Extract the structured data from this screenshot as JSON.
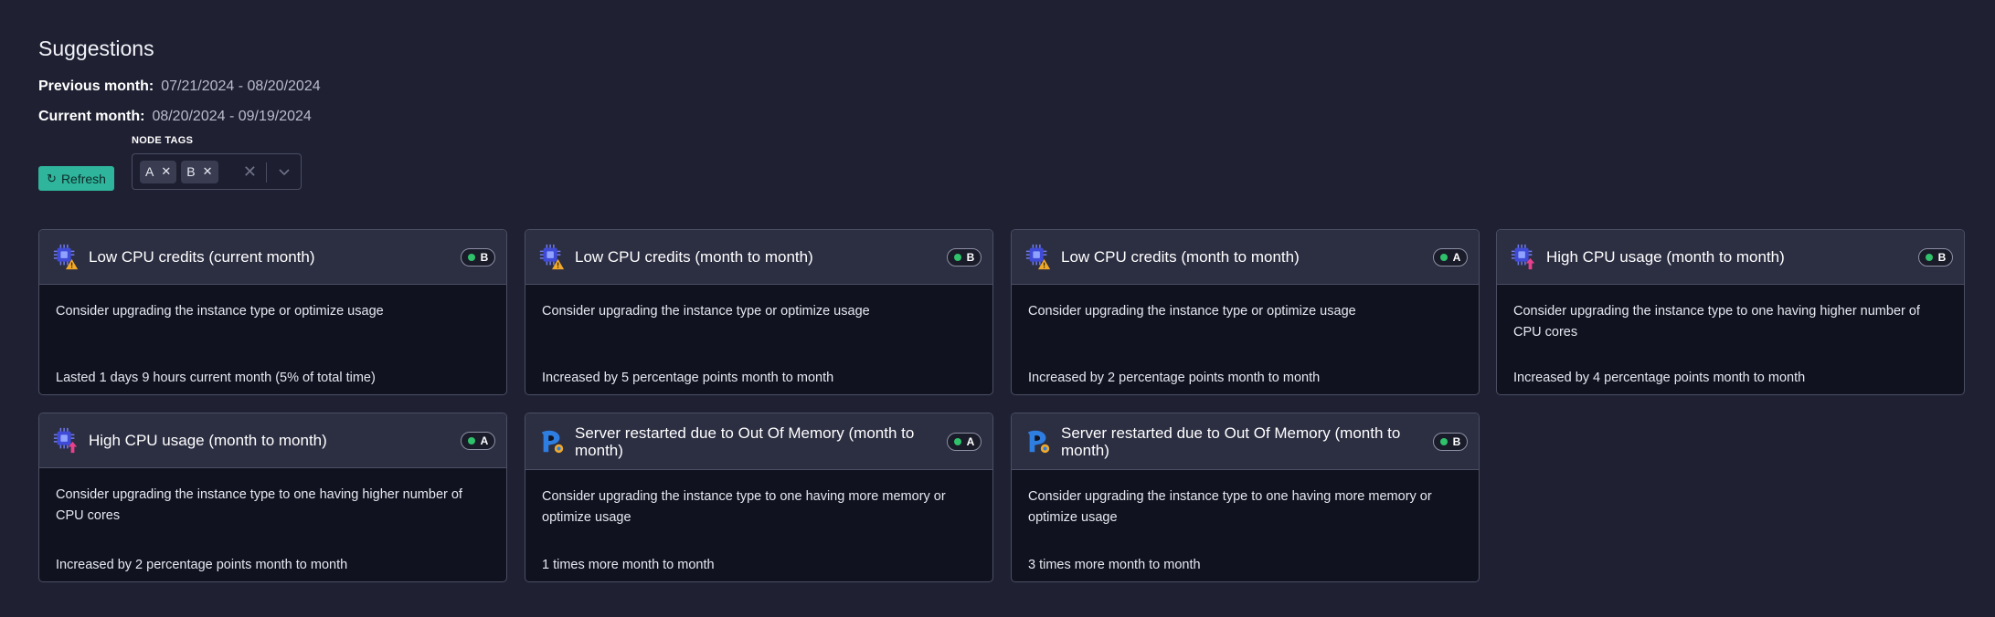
{
  "header": {
    "title": "Suggestions",
    "previous_label": "Previous month:",
    "previous_value": "07/21/2024 - 08/20/2024",
    "current_label": "Current month:",
    "current_value": "08/20/2024 - 09/19/2024"
  },
  "controls": {
    "refresh_label": "Refresh",
    "tags_label": "NODE TAGS",
    "tags": [
      "A",
      "B"
    ]
  },
  "colors": {
    "accent": "#2fb59b",
    "status_dot": "#2fc26b",
    "background": "#1f2133"
  },
  "cards": [
    {
      "title": "Low CPU credits (current month)",
      "badge": "B",
      "icon": "cpu-warning-icon",
      "description": "Consider upgrading the instance type or optimize usage",
      "footer": "Lasted 1 days 9 hours current month (5% of total time)"
    },
    {
      "title": "Low CPU credits (month to month)",
      "badge": "B",
      "icon": "cpu-warning-icon",
      "description": "Consider upgrading the instance type or optimize usage",
      "footer": "Increased by 5 percentage points month to month"
    },
    {
      "title": "Low CPU credits (month to month)",
      "badge": "A",
      "icon": "cpu-warning-icon",
      "description": "Consider upgrading the instance type or optimize usage",
      "footer": "Increased by 2 percentage points month to month"
    },
    {
      "title": "High CPU usage (month to month)",
      "badge": "B",
      "icon": "cpu-high-usage-icon",
      "description": "Consider upgrading the instance type to one having higher number of CPU cores",
      "footer": "Increased by 4 percentage points month to month"
    },
    {
      "title": "High CPU usage (month to month)",
      "badge": "A",
      "icon": "cpu-high-usage-icon",
      "description": "Consider upgrading the instance type to one having higher number of CPU cores",
      "footer": "Increased by 2 percentage points month to month"
    },
    {
      "title": "Server restarted due to Out Of Memory (month to month)",
      "badge": "A",
      "icon": "server-restart-icon",
      "description": "Consider upgrading the instance type to one having more memory or optimize usage",
      "footer": "1 times more month to month"
    },
    {
      "title": "Server restarted due to Out Of Memory (month to month)",
      "badge": "B",
      "icon": "server-restart-icon",
      "description": "Consider upgrading the instance type to one having more memory or optimize usage",
      "footer": "3 times more month to month"
    }
  ]
}
